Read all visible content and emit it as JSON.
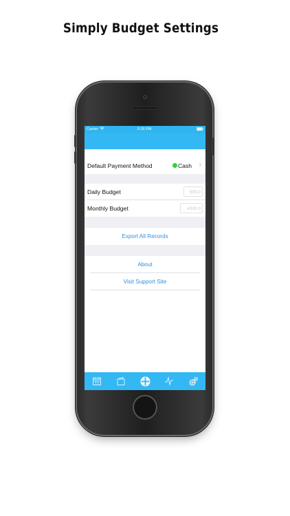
{
  "promo": {
    "title": "Simply Budget Settings"
  },
  "status_bar": {
    "carrier": "Carrier",
    "time": "5:26 PM"
  },
  "settings": {
    "payment_method_label": "Default Payment Method",
    "payment_method_value": "Cash",
    "daily_budget_label": "Daily Budget",
    "daily_budget_placeholder": "500.0",
    "monthly_budget_label": "Monthly Budget",
    "monthly_budget_placeholder": "4000.0",
    "export_label": "Export All Records",
    "about_label": "About",
    "support_label": "Visit Support Site"
  },
  "tabs": [
    {
      "icon": "calendar-icon"
    },
    {
      "icon": "wallet-icon"
    },
    {
      "icon": "add-circle-icon"
    },
    {
      "icon": "chart-pulse-icon"
    },
    {
      "icon": "gears-icon"
    }
  ],
  "colors": {
    "accent": "#34b8f4",
    "link": "#2f8fde",
    "status_dot": "#2bd53a"
  }
}
